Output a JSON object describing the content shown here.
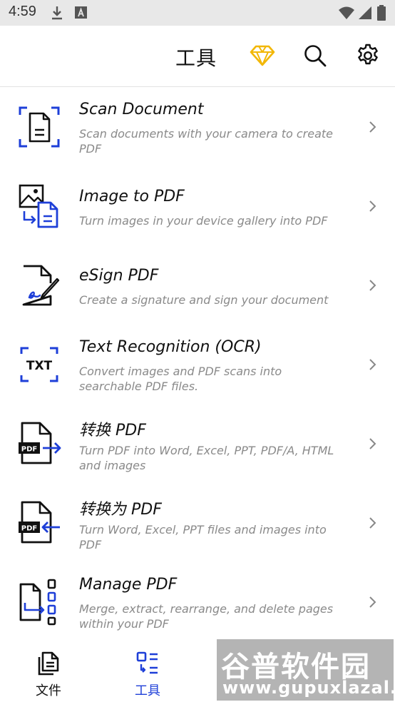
{
  "status_bar": {
    "time": "4:59",
    "icons": [
      "download-icon",
      "a-notification-icon",
      "wifi-icon",
      "cellular-icon",
      "battery-icon"
    ]
  },
  "app_bar": {
    "title": "工具",
    "actions": [
      "premium-diamond-icon",
      "search-icon",
      "settings-gear-icon"
    ],
    "premium_color": "#F2B705"
  },
  "tools": [
    {
      "title": "Scan Document",
      "description": "Scan documents with your camera to create PDF",
      "icon": "scan-document-icon"
    },
    {
      "title": "Image to PDF",
      "description": "Turn images in your device gallery into PDF",
      "icon": "image-to-pdf-icon"
    },
    {
      "title": "eSign PDF",
      "description": "Create a signature and sign your document",
      "icon": "esign-icon"
    },
    {
      "title": "Text Recognition (OCR)",
      "description": "Convert images and PDF scans into searchable PDF files.",
      "icon": "ocr-txt-icon",
      "icon_text": "TXT"
    },
    {
      "title": "转换 PDF",
      "description": "Turn PDF into Word, Excel, PPT, PDF/A, HTML and images",
      "icon": "convert-from-pdf-icon",
      "icon_text": "PDF"
    },
    {
      "title": "转换为 PDF",
      "description": "Turn Word, Excel, PPT files and images into PDF",
      "icon": "convert-to-pdf-icon",
      "icon_text": "PDF"
    },
    {
      "title": "Manage PDF",
      "description": "Merge, extract, rearrange, and delete pages within your PDF",
      "icon": "manage-pdf-icon"
    }
  ],
  "bottom_nav": {
    "items": [
      {
        "label": "文件",
        "icon": "files-icon",
        "active": false
      },
      {
        "label": "工具",
        "icon": "tools-icon",
        "active": true
      }
    ]
  },
  "watermark": {
    "text_cn": "谷普软件园",
    "url": "www.gupuxlazal.com"
  },
  "colors": {
    "accent_blue": "#1E3FD8",
    "text_primary": "#111111",
    "text_secondary": "#8A8A8A",
    "status_bar_bg": "#E8E8E8"
  }
}
